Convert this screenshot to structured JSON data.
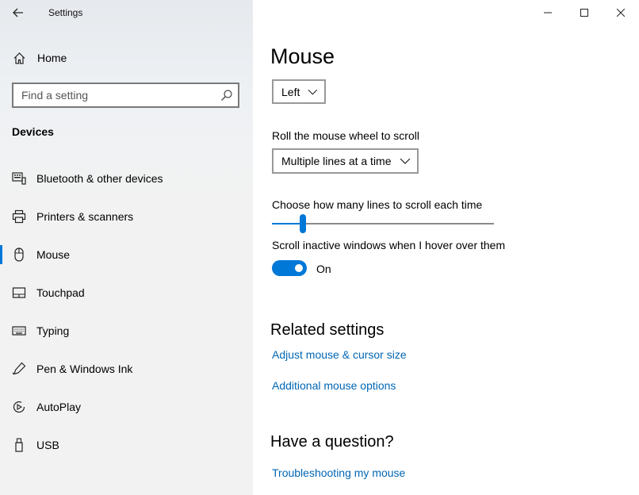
{
  "window": {
    "title": "Settings"
  },
  "sidebar": {
    "home_label": "Home",
    "search": {
      "placeholder": "Find a setting"
    },
    "section_title": "Devices",
    "items": [
      {
        "label": "Bluetooth & other devices",
        "icon": "bluetooth-devices-icon"
      },
      {
        "label": "Printers & scanners",
        "icon": "printer-icon"
      },
      {
        "label": "Mouse",
        "icon": "mouse-icon",
        "selected": true
      },
      {
        "label": "Touchpad",
        "icon": "touchpad-icon"
      },
      {
        "label": "Typing",
        "icon": "keyboard-icon"
      },
      {
        "label": "Pen & Windows Ink",
        "icon": "pen-icon"
      },
      {
        "label": "AutoPlay",
        "icon": "autoplay-icon"
      },
      {
        "label": "USB",
        "icon": "usb-icon"
      }
    ]
  },
  "main": {
    "title": "Mouse",
    "primary_button_dropdown": {
      "value": "Left"
    },
    "scroll_mode": {
      "label": "Roll the mouse wheel to scroll",
      "value": "Multiple lines at a time"
    },
    "lines_slider": {
      "label": "Choose how many lines to scroll each time",
      "value_fraction": 0.13
    },
    "inactive_scroll": {
      "label": "Scroll inactive windows when I hover over them",
      "state": "On",
      "enabled": true
    },
    "related": {
      "title": "Related settings",
      "links": [
        "Adjust mouse & cursor size",
        "Additional mouse options"
      ]
    },
    "question": {
      "title": "Have a question?",
      "links": [
        "Troubleshooting my mouse"
      ]
    }
  },
  "colors": {
    "accent": "#0078d7",
    "link": "#0066b4",
    "sidebar_bg": "#f2f2f2"
  }
}
